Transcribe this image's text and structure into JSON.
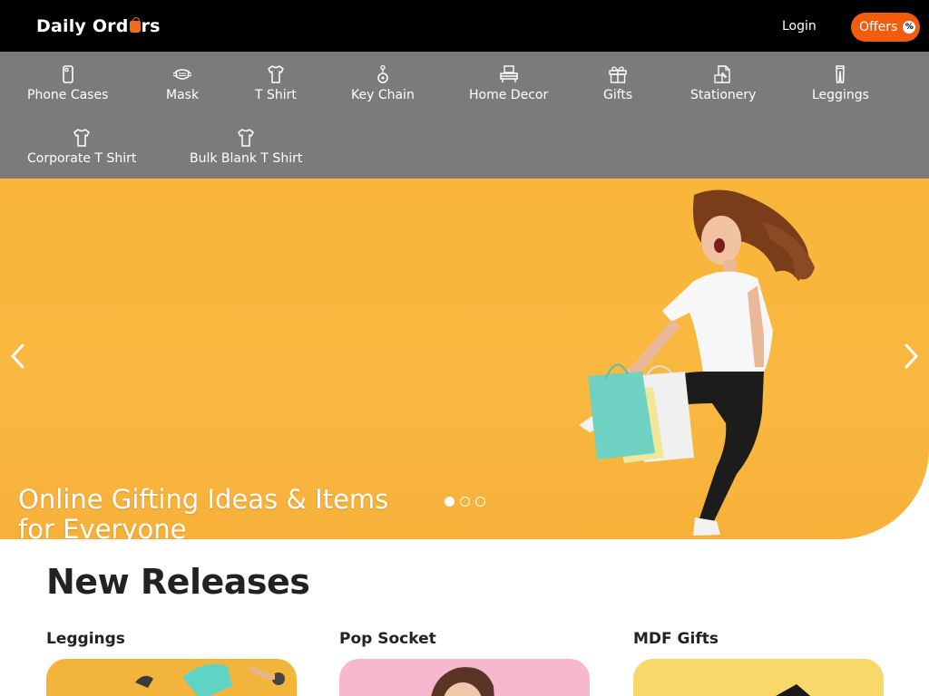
{
  "header": {
    "logo_text_a": "Daily Ord",
    "logo_text_b": "rs",
    "login_label": "Login",
    "offers_label": "Offers",
    "offers_badge": "%"
  },
  "categories": [
    {
      "label": "Phone Cases",
      "icon": "phone-case-icon"
    },
    {
      "label": "Mask",
      "icon": "mask-icon"
    },
    {
      "label": "T Shirt",
      "icon": "tshirt-icon"
    },
    {
      "label": "Key Chain",
      "icon": "keychain-icon"
    },
    {
      "label": "Home Decor",
      "icon": "home-decor-icon"
    },
    {
      "label": "Gifts",
      "icon": "gift-icon"
    },
    {
      "label": "Stationery",
      "icon": "stationery-icon"
    },
    {
      "label": "Leggings",
      "icon": "leggings-icon"
    },
    {
      "label": "Corporate T Shirt",
      "icon": "tshirt-icon"
    },
    {
      "label": "Bulk Blank T Shirt",
      "icon": "tshirt-icon"
    }
  ],
  "hero": {
    "title": "Online Gifting Ideas & Items for Everyone",
    "slides": 3,
    "active_slide": 1
  },
  "new_releases": {
    "title": "New Releases",
    "cards": [
      {
        "title": "Leggings"
      },
      {
        "title": "Pop Socket"
      },
      {
        "title": "MDF Gifts"
      }
    ]
  },
  "colors": {
    "header_bg": "#000000",
    "nav_bg": "#7b7b7b",
    "accent": "#f25c0f",
    "hero_bg": "#f8b53a"
  }
}
